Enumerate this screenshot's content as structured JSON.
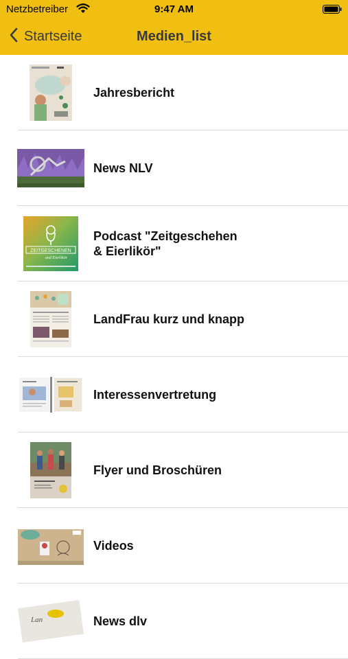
{
  "status_bar": {
    "carrier": "Netzbetreiber",
    "time": "9:47 AM",
    "wifi_icon": "wifi-icon",
    "battery_icon": "battery-icon"
  },
  "nav": {
    "back_label": "Startseite",
    "back_icon": "chevron-left-icon",
    "title": "Medien_list"
  },
  "colors": {
    "accent": "#F0BF12",
    "separator": "#dcdcdc",
    "text": "#111111"
  },
  "items": [
    {
      "label": "Jahresbericht",
      "thumb": "report-cover"
    },
    {
      "label": "News NLV",
      "thumb": "lavender-photo"
    },
    {
      "label": "Podcast \"Zeitgeschehen\n& Eierlikör\"",
      "thumb": "podcast-cover"
    },
    {
      "label": "LandFrau kurz und knapp",
      "thumb": "newsletter-cover"
    },
    {
      "label": "Interessenvertretung",
      "thumb": "brochures-spread"
    },
    {
      "label": "Flyer und Broschüren",
      "thumb": "flyer-cover"
    },
    {
      "label": "Videos",
      "thumb": "video-still"
    },
    {
      "label": "News dlv",
      "thumb": "dlv-logo"
    }
  ],
  "podcast_thumb": {
    "line1": "ZEITGESCHENEN",
    "line2": "und Eierlikör"
  }
}
